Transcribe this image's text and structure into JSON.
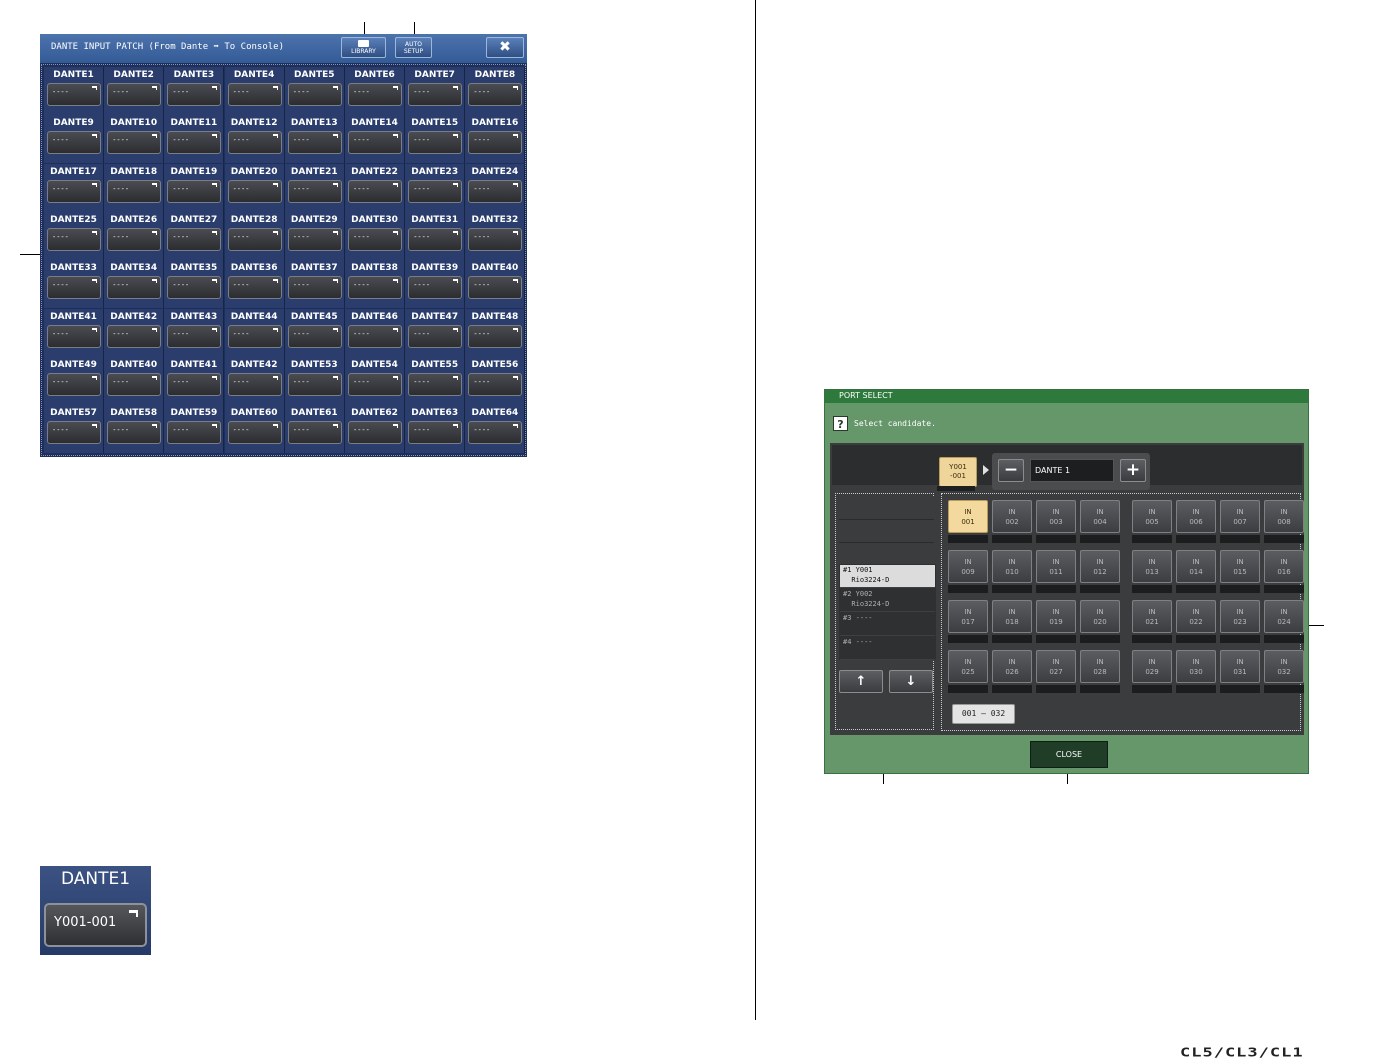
{
  "dante_patch": {
    "title": "DANTE INPUT PATCH (From Dante ➡ To Console)",
    "library_label": "LIBRARY",
    "auto_setup_line1": "AUTO",
    "auto_setup_line2": "SETUP",
    "close_label": "✖",
    "channels": [
      {
        "label": "DANTE1",
        "port": "----"
      },
      {
        "label": "DANTE2",
        "port": "----"
      },
      {
        "label": "DANTE3",
        "port": "----"
      },
      {
        "label": "DANTE4",
        "port": "----"
      },
      {
        "label": "DANTE5",
        "port": "----"
      },
      {
        "label": "DANTE6",
        "port": "----"
      },
      {
        "label": "DANTE7",
        "port": "----"
      },
      {
        "label": "DANTE8",
        "port": "----"
      },
      {
        "label": "DANTE9",
        "port": "----"
      },
      {
        "label": "DANTE10",
        "port": "----"
      },
      {
        "label": "DANTE11",
        "port": "----"
      },
      {
        "label": "DANTE12",
        "port": "----"
      },
      {
        "label": "DANTE13",
        "port": "----"
      },
      {
        "label": "DANTE14",
        "port": "----"
      },
      {
        "label": "DANTE15",
        "port": "----"
      },
      {
        "label": "DANTE16",
        "port": "----"
      },
      {
        "label": "DANTE17",
        "port": "----"
      },
      {
        "label": "DANTE18",
        "port": "----"
      },
      {
        "label": "DANTE19",
        "port": "----"
      },
      {
        "label": "DANTE20",
        "port": "----"
      },
      {
        "label": "DANTE21",
        "port": "----"
      },
      {
        "label": "DANTE22",
        "port": "----"
      },
      {
        "label": "DANTE23",
        "port": "----"
      },
      {
        "label": "DANTE24",
        "port": "----"
      },
      {
        "label": "DANTE25",
        "port": "----"
      },
      {
        "label": "DANTE26",
        "port": "----"
      },
      {
        "label": "DANTE27",
        "port": "----"
      },
      {
        "label": "DANTE28",
        "port": "----"
      },
      {
        "label": "DANTE29",
        "port": "----"
      },
      {
        "label": "DANTE30",
        "port": "----"
      },
      {
        "label": "DANTE31",
        "port": "----"
      },
      {
        "label": "DANTE32",
        "port": "----"
      },
      {
        "label": "DANTE33",
        "port": "----"
      },
      {
        "label": "DANTE34",
        "port": "----"
      },
      {
        "label": "DANTE35",
        "port": "----"
      },
      {
        "label": "DANTE36",
        "port": "----"
      },
      {
        "label": "DANTE37",
        "port": "----"
      },
      {
        "label": "DANTE38",
        "port": "----"
      },
      {
        "label": "DANTE39",
        "port": "----"
      },
      {
        "label": "DANTE40",
        "port": "----"
      },
      {
        "label": "DANTE41",
        "port": "----"
      },
      {
        "label": "DANTE42",
        "port": "----"
      },
      {
        "label": "DANTE43",
        "port": "----"
      },
      {
        "label": "DANTE44",
        "port": "----"
      },
      {
        "label": "DANTE45",
        "port": "----"
      },
      {
        "label": "DANTE46",
        "port": "----"
      },
      {
        "label": "DANTE47",
        "port": "----"
      },
      {
        "label": "DANTE48",
        "port": "----"
      },
      {
        "label": "DANTE49",
        "port": "----"
      },
      {
        "label": "DANTE40",
        "port": "----"
      },
      {
        "label": "DANTE41",
        "port": "----"
      },
      {
        "label": "DANTE42",
        "port": "----"
      },
      {
        "label": "DANTE53",
        "port": "----"
      },
      {
        "label": "DANTE54",
        "port": "----"
      },
      {
        "label": "DANTE55",
        "port": "----"
      },
      {
        "label": "DANTE56",
        "port": "----"
      },
      {
        "label": "DANTE57",
        "port": "----"
      },
      {
        "label": "DANTE58",
        "port": "----"
      },
      {
        "label": "DANTE59",
        "port": "----"
      },
      {
        "label": "DANTE60",
        "port": "----"
      },
      {
        "label": "DANTE61",
        "port": "----"
      },
      {
        "label": "DANTE62",
        "port": "----"
      },
      {
        "label": "DANTE63",
        "port": "----"
      },
      {
        "label": "DANTE64",
        "port": "----"
      }
    ]
  },
  "zoom_example": {
    "label": "DANTE1",
    "port": "Y001-001"
  },
  "port_select": {
    "title": "PORT SELECT",
    "help_icon": "?",
    "prompt": "Select candidate.",
    "slot_line1": "Y001",
    "slot_line2": "-001",
    "minus_label": "−",
    "plus_label": "+",
    "selected_name": "DANTE 1",
    "devices": [
      {
        "line1": "#1 Y001",
        "line2": "  Rio3224-D",
        "selected": true
      },
      {
        "line1": "#2 Y002",
        "line2": "  Rio3224-D",
        "selected": false
      },
      {
        "line1": "#3 ----",
        "line2": "",
        "selected": false
      },
      {
        "line1": "#4 ----",
        "line2": "",
        "selected": false
      }
    ],
    "up_label": "↑",
    "down_label": "↓",
    "ports": [
      {
        "top": "IN",
        "num": "001"
      },
      {
        "top": "IN",
        "num": "002"
      },
      {
        "top": "IN",
        "num": "003"
      },
      {
        "top": "IN",
        "num": "004"
      },
      {
        "top": "IN",
        "num": "005"
      },
      {
        "top": "IN",
        "num": "006"
      },
      {
        "top": "IN",
        "num": "007"
      },
      {
        "top": "IN",
        "num": "008"
      },
      {
        "top": "IN",
        "num": "009"
      },
      {
        "top": "IN",
        "num": "010"
      },
      {
        "top": "IN",
        "num": "011"
      },
      {
        "top": "IN",
        "num": "012"
      },
      {
        "top": "IN",
        "num": "013"
      },
      {
        "top": "IN",
        "num": "014"
      },
      {
        "top": "IN",
        "num": "015"
      },
      {
        "top": "IN",
        "num": "016"
      },
      {
        "top": "IN",
        "num": "017"
      },
      {
        "top": "IN",
        "num": "018"
      },
      {
        "top": "IN",
        "num": "019"
      },
      {
        "top": "IN",
        "num": "020"
      },
      {
        "top": "IN",
        "num": "021"
      },
      {
        "top": "IN",
        "num": "022"
      },
      {
        "top": "IN",
        "num": "023"
      },
      {
        "top": "IN",
        "num": "024"
      },
      {
        "top": "IN",
        "num": "025"
      },
      {
        "top": "IN",
        "num": "026"
      },
      {
        "top": "IN",
        "num": "027"
      },
      {
        "top": "IN",
        "num": "028"
      },
      {
        "top": "IN",
        "num": "029"
      },
      {
        "top": "IN",
        "num": "030"
      },
      {
        "top": "IN",
        "num": "031"
      },
      {
        "top": "IN",
        "num": "032"
      }
    ],
    "active_port": "001",
    "range_label": "001 – 032",
    "close_label": "CLOSE"
  },
  "footer": {
    "model_text": "CL5/CL3/CL1"
  }
}
